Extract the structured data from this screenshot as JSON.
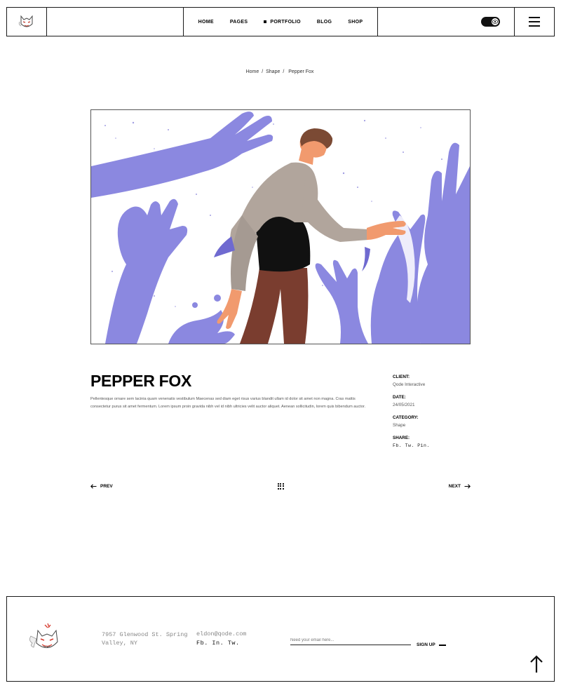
{
  "header": {
    "nav": [
      {
        "label": "HOME",
        "active": false
      },
      {
        "label": "PAGES",
        "active": false
      },
      {
        "label": "PORTFOLIO",
        "active": true
      },
      {
        "label": "BLOG",
        "active": false
      },
      {
        "label": "SHOP",
        "active": false
      }
    ],
    "icons": {
      "logo": "fox-logo-icon",
      "toggle": "eye-toggle-icon",
      "menu": "hamburger-icon"
    }
  },
  "breadcrumb": {
    "home": "Home",
    "sep1": "/",
    "category": "Shape",
    "sep2": "/",
    "current": "Pepper Fox"
  },
  "project": {
    "title": "PEPPER FOX",
    "description": "Pellentesque ornare sem lacinia quam venenatis vestibulum Maecenas sed diam eget risus varius blandit ullam id dolor sit amet non magna. Cras mattis consectetur purus sit amet fermentum. Lorem ipsum proin gravida nibh vel id nibh ultricies velit auctor aliquet. Aenean sollicitudin, lorem quis bibendum auctor.",
    "client_label": "CLIENT:",
    "client_value": "Qode Interactive",
    "date_label": "DATE:",
    "date_value": "24/05/2021",
    "category_label": "CATEGORY:",
    "category_value": "Shape",
    "share_label": "SHARE:",
    "share_value": "Fb. Tw. Pin."
  },
  "pager": {
    "prev": "PREV",
    "next": "NEXT"
  },
  "footer": {
    "address": "7957 Glenwood St. Spring Valley, NY",
    "email": "eldon@qode.com",
    "social": "Fb. In. Tw.",
    "email_placeholder": "Need your email here...",
    "signup": "SIGN UP"
  },
  "colors": {
    "accent_purple": "#8b88e0",
    "shirt": "#b1a59c",
    "trousers": "#7a3d2f",
    "hair": "#7b4a34",
    "skin": "#f19a6e"
  }
}
